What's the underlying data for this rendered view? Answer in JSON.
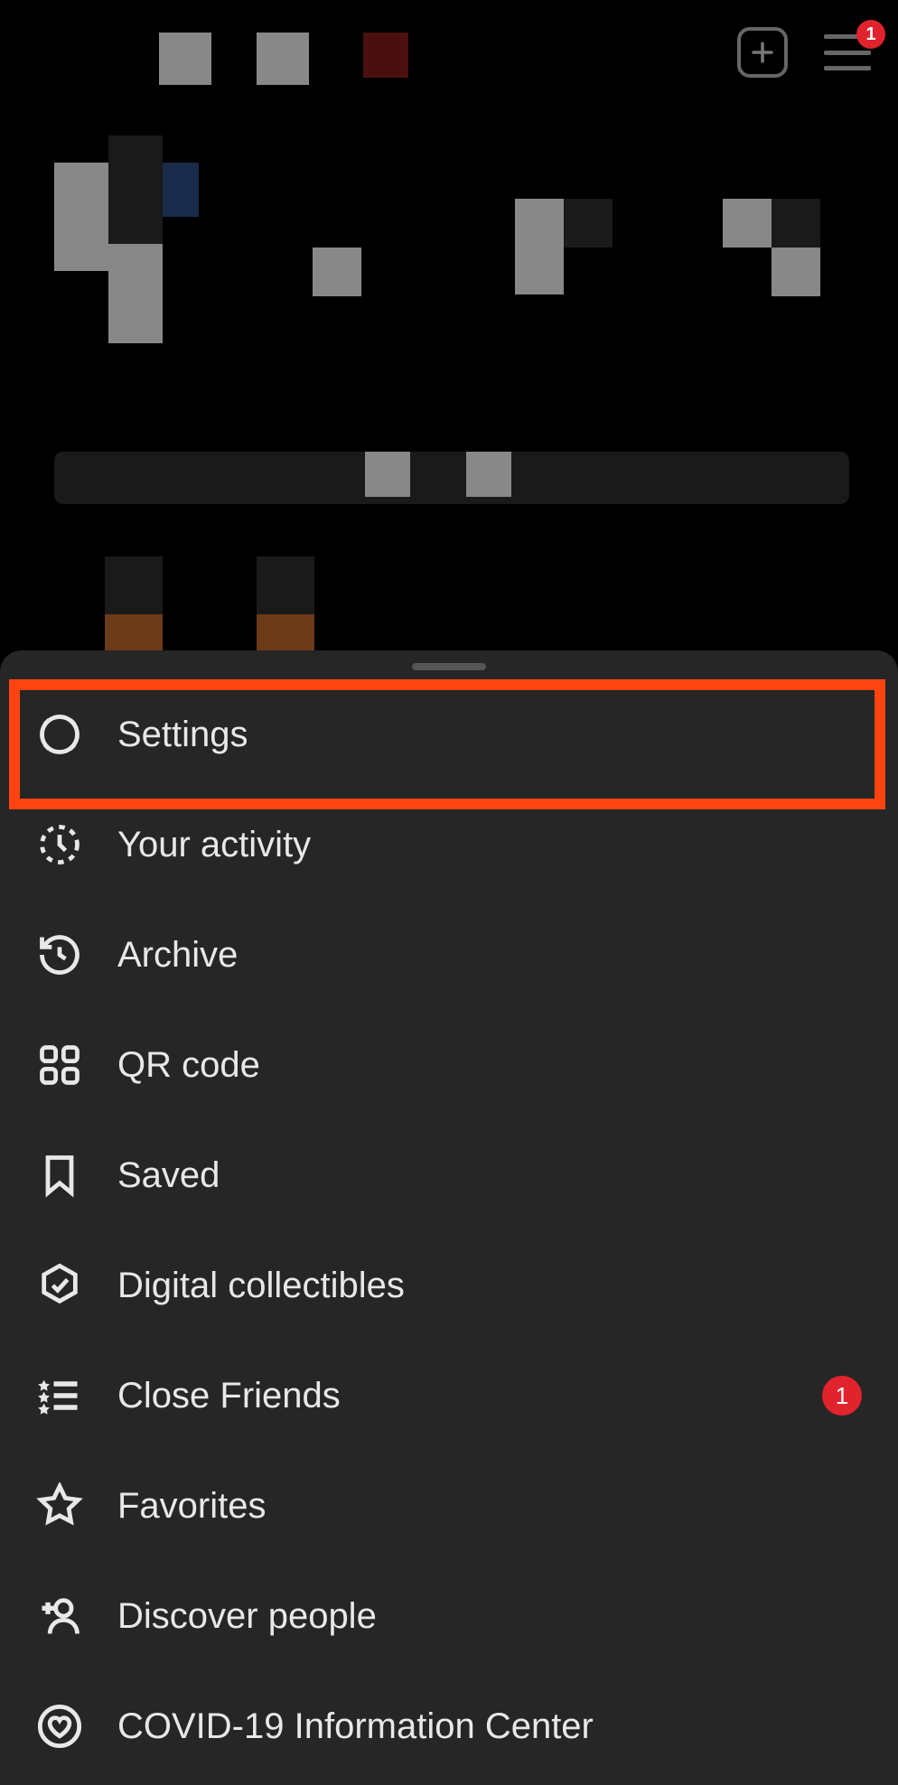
{
  "header": {
    "menu_badge": "1"
  },
  "sheet": {
    "items": [
      {
        "label": "Settings",
        "highlighted": true
      },
      {
        "label": "Your activity"
      },
      {
        "label": "Archive"
      },
      {
        "label": "QR code"
      },
      {
        "label": "Saved"
      },
      {
        "label": "Digital collectibles"
      },
      {
        "label": "Close Friends",
        "badge": "1"
      },
      {
        "label": "Favorites"
      },
      {
        "label": "Discover people"
      },
      {
        "label": "COVID-19 Information Center"
      }
    ]
  }
}
